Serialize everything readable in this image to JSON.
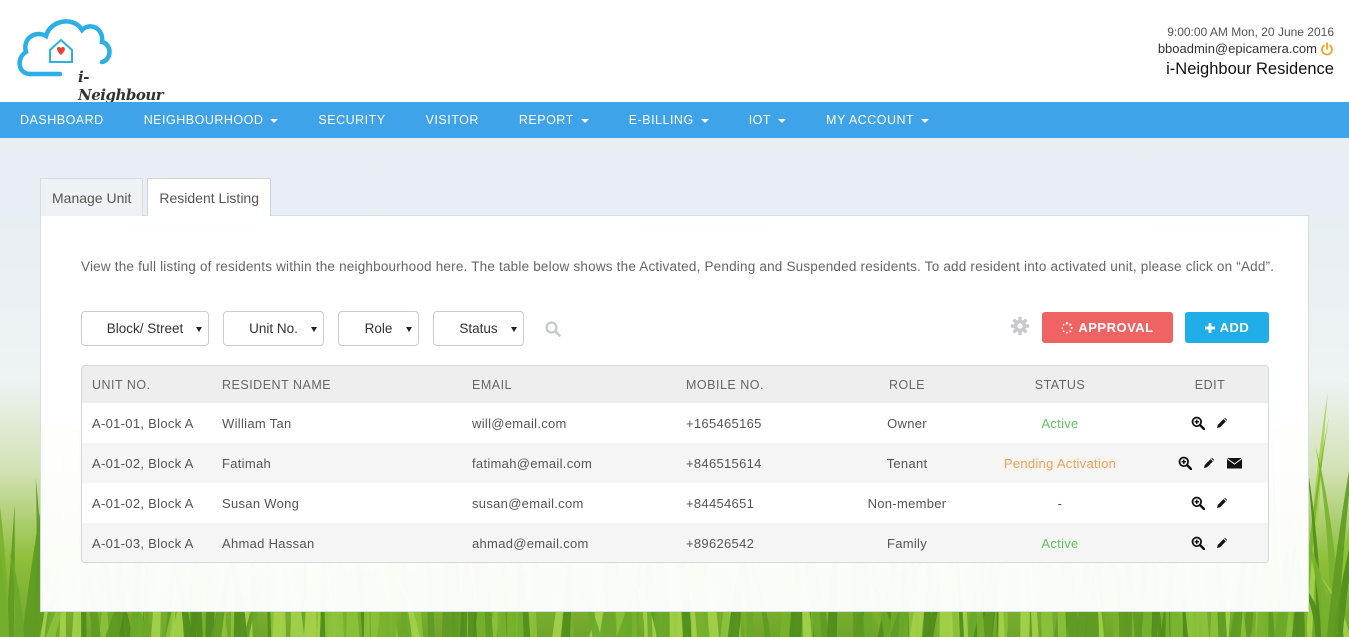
{
  "header": {
    "logo_text": "i-Neighbour",
    "datetime": "9:00:00 AM Mon, 20 June 2016",
    "user_email": "bboadmin@epicamera.com",
    "residence_name": "i-Neighbour Residence"
  },
  "nav": {
    "items": [
      {
        "label": "DASHBOARD",
        "dropdown": false
      },
      {
        "label": "NEIGHBOURHOOD",
        "dropdown": true
      },
      {
        "label": "SECURITY",
        "dropdown": false
      },
      {
        "label": "VISITOR",
        "dropdown": false
      },
      {
        "label": "REPORT",
        "dropdown": true
      },
      {
        "label": "E-BILLING",
        "dropdown": true
      },
      {
        "label": "IOT",
        "dropdown": true
      },
      {
        "label": "MY ACCOUNT",
        "dropdown": true
      }
    ]
  },
  "tabs": [
    {
      "label": "Manage Unit",
      "active": false
    },
    {
      "label": "Resident Listing",
      "active": true
    }
  ],
  "description": "View the full listing of residents within the neighbourhood here. The table below shows the Activated, Pending and Suspended residents. To add resident into activated unit, please click on “Add”.",
  "filters": {
    "block": "Block/ Street",
    "unit": "Unit No.",
    "role": "Role",
    "status": "Status"
  },
  "buttons": {
    "approval": "APPROVAL",
    "add": "ADD"
  },
  "table": {
    "columns": [
      "UNIT NO.",
      "RESIDENT NAME",
      "EMAIL",
      "MOBILE NO.",
      "ROLE",
      "STATUS",
      "EDIT"
    ],
    "rows": [
      {
        "unit": "A-01-01, Block A",
        "name": "William Tan",
        "email": "will@email.com",
        "mobile": "+165465165",
        "role": "Owner",
        "status": "Active",
        "status_type": "active",
        "mail_icon": false
      },
      {
        "unit": "A-01-02, Block A",
        "name": "Fatimah",
        "email": "fatimah@email.com",
        "mobile": "+846515614",
        "role": "Tenant",
        "status": "Pending Activation",
        "status_type": "pending",
        "mail_icon": true
      },
      {
        "unit": "A-01-02, Block A",
        "name": "Susan Wong",
        "email": "susan@email.com",
        "mobile": "+84454651",
        "role": "Non-member",
        "status": "-",
        "status_type": "none",
        "mail_icon": false
      },
      {
        "unit": "A-01-03, Block A",
        "name": "Ahmad Hassan",
        "email": "ahmad@email.com",
        "mobile": "+89626542",
        "role": "Family",
        "status": "Active",
        "status_type": "active",
        "mail_icon": false
      }
    ]
  },
  "colors": {
    "nav_bg": "#3ea3e8",
    "approval_bg": "#ef6363",
    "add_bg": "#1faee8",
    "status_active": "#5ec45e",
    "status_pending": "#f0a150",
    "logo_blue": "#2ab0e6",
    "logo_heart": "#e8403a",
    "power_icon": "#f5a623"
  },
  "icons": {
    "power": "power-icon",
    "gear": "gear-icon",
    "search": "search-icon",
    "view": "zoom-in-icon",
    "edit": "pencil-icon",
    "mail": "envelope-icon"
  }
}
